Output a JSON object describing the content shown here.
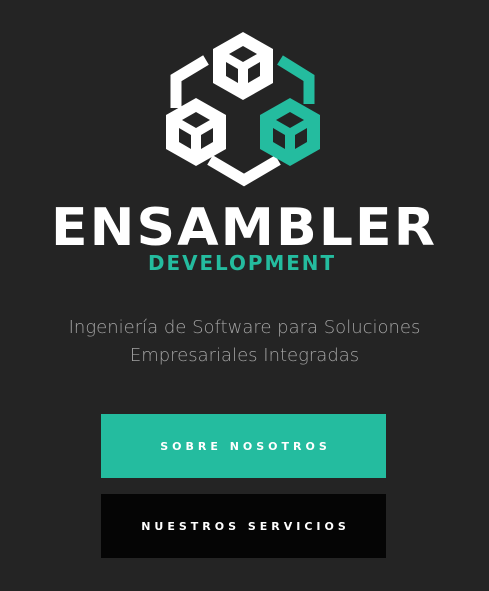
{
  "brand": {
    "name": "ENSAMBLER",
    "subname": "DEVELOPMENT",
    "accent_color": "#24bc9f",
    "logo_icon": "three-cubes-icon"
  },
  "tagline": {
    "line1": "Ingeniería de Software para Soluciones",
    "line2": "Empresariales Integradas"
  },
  "buttons": {
    "about_label": "SOBRE NOSOTROS",
    "services_label": "NUESTROS SERVICIOS"
  }
}
